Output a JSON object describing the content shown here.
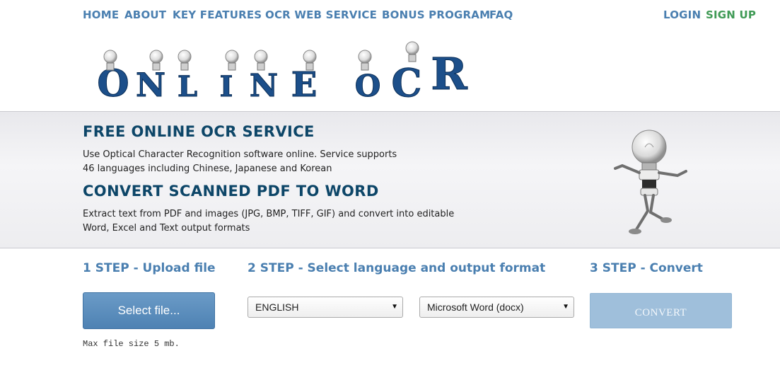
{
  "nav": {
    "home": "HOME",
    "about": "ABOUT",
    "key_features": "KEY FEATURES",
    "ocr_web_service": "OCR WEB SERVICE",
    "bonus_program": "BONUS PROGRAM",
    "faq": "FAQ",
    "login": "LOGIN",
    "signup": "SIGN UP"
  },
  "logo": {
    "word1": [
      "O",
      "N",
      "L",
      "I",
      "N",
      "E"
    ],
    "word2": [
      "O",
      "C",
      "R"
    ],
    "icon": "lightbulb-robot-icon"
  },
  "hero": {
    "title1": "FREE ONLINE OCR SERVICE",
    "desc1_line1": "Use Optical Character Recognition software online. Service supports",
    "desc1_line2": "46 languages including Chinese, Japanese and Korean",
    "title2": "CONVERT SCANNED PDF TO WORD",
    "desc2_line1": "Extract text from PDF and images (JPG, BMP, TIFF, GIF) and convert into editable",
    "desc2_line2": "Word, Excel and Text output formats",
    "mascot_icon": "lightbulb-robot-icon"
  },
  "steps": {
    "step1": "1 STEP - Upload file",
    "step2": "2 STEP - Select language and output format",
    "step3": "3 STEP - Convert"
  },
  "upload": {
    "button_label": "Select file...",
    "max_size": "Max file size 5 mb."
  },
  "language_select": {
    "value": "ENGLISH"
  },
  "format_select": {
    "value": "Microsoft Word (docx)"
  },
  "convert": {
    "label": "CONVERT"
  },
  "colors": {
    "nav_link": "#4a7fb0",
    "signup": "#3f9a55",
    "heading": "#0d4668",
    "button": "#4e82b3",
    "convert_disabled": "#9fbfdb"
  }
}
